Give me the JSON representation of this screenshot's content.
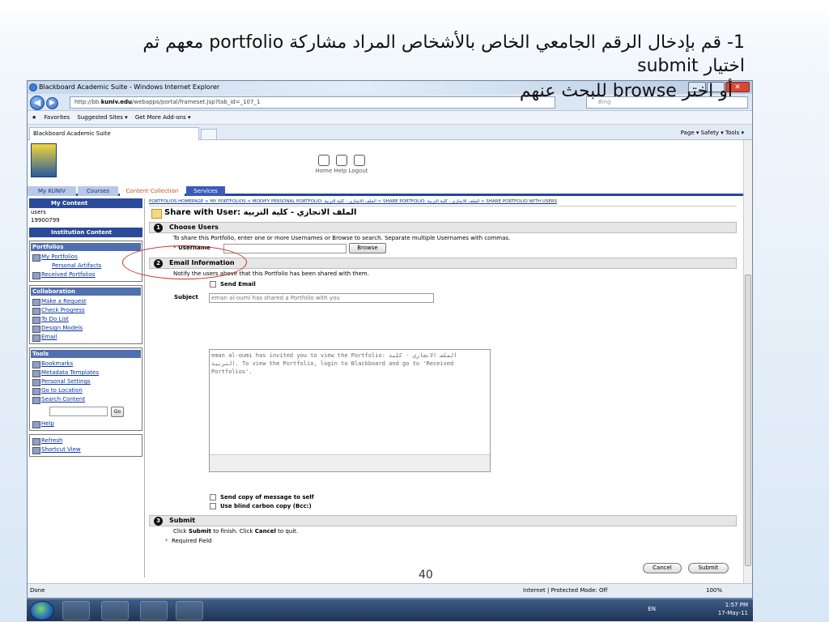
{
  "slide": {
    "title_line1": "1- قم بإدخال الرقم الجامعي الخاص بالأشخاص المراد مشاركة portfolio معهم ثم",
    "title_line2": "اختيار submit",
    "note": "أو اختر browse للبحث عنهم",
    "page_number": "40"
  },
  "browser": {
    "window_title": "Blackboard Academic Suite - Windows Internet Explorer",
    "url_prefix": "http://bb.",
    "url_host": "kuniv.edu",
    "url_path": "/webapps/portal/frameset.jsp?tab_id=_107_1",
    "search_placeholder": "Bing",
    "favorites_label": "Favorites",
    "suggested_sites": "Suggested Sites ▾",
    "get_addons": "Get More Add-ons ▾",
    "tab_title": "Blackboard Academic Suite",
    "cmd_items": "Page ▾  Safety ▾  Tools ▾",
    "status_left": "Done",
    "status_zone": "Internet | Protected Mode: Off",
    "zoom": "100%"
  },
  "bb": {
    "header_links": "Home  Help  Logout",
    "tabs": [
      "My KUNIV",
      "Courses",
      "Content Collection",
      "Services"
    ]
  },
  "sidebar": {
    "my_content": "My Content",
    "users": "users",
    "user_id": "19900799",
    "institution_content": "Institution Content",
    "portfolios": {
      "heading": "Portfolios",
      "items": [
        "My Portfolios",
        "Personal Artifacts",
        "Received Portfolios"
      ]
    },
    "collaboration": {
      "heading": "Collaboration",
      "items": [
        "Make a Request",
        "Check Progress",
        "To Do List",
        "Design Models",
        "Email"
      ]
    },
    "tools": {
      "heading": "Tools",
      "items": [
        "Bookmarks",
        "Metadata Templates",
        "Personal Settings",
        "Go to Location",
        "Search Content"
      ],
      "go": "Go",
      "help": "Help"
    },
    "bottom": [
      "Refresh",
      "Shortcut View"
    ]
  },
  "content": {
    "breadcrumb": [
      "PORTFOLIOS HOMEPAGE",
      "MY PORTFOLIOS",
      "MODIFY PERSONAL PORTFOLIO: الملف الانجازي - كلية التربية",
      "SHARE PORTFOLIO: الملف الانجازي - كلية التربية"
    ],
    "breadcrumb_last": "SHARE PORTFOLIO WITH USERS",
    "page_title": "Share with User: الملف الانجازي - كلية التربية",
    "step1": "Choose Users",
    "step1_text": "To share this Portfolio, enter one or more Usernames or Browse to search. Separate multiple Usernames with commas.",
    "username_label": "Username",
    "browse": "Browse",
    "step2": "Email Information",
    "step2_text": "Notify the users above that this Portfolio has been shared with them.",
    "send_email": "Send Email",
    "subject_label": "Subject",
    "subject_value": "eman al-oumi has shared a Portfolio with you",
    "message": "eman al-oumi has invited you to view the Portfolio: الملف الانجازي - كلية التربية. To view the Portfolio, login to Blackboard and go to 'Received Portfolios'.",
    "send_copy": "Send copy of message to self",
    "use_bcc": "Use blind carbon copy (Bcc:)",
    "step3": "Submit",
    "submit_text_pre": "Click ",
    "submit_word": "Submit",
    "submit_text_mid": " to finish. Click ",
    "cancel_word": "Cancel",
    "submit_text_post": " to quit.",
    "required_field": "Required Field",
    "cancel_btn": "Cancel",
    "submit_btn": "Submit"
  },
  "taskbar": {
    "lang": "EN",
    "time": "1:57 PM",
    "date": "17-May-11"
  },
  "colors": {
    "bb_blue": "#2b4a9a",
    "annotation_red": "#c93128"
  }
}
